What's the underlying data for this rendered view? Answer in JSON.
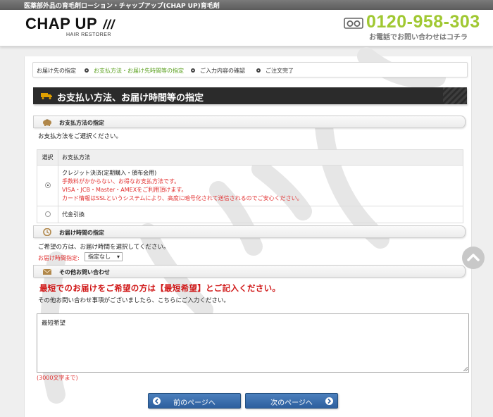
{
  "topbar": {
    "text": "医薬部外品の育毛剤ローション・チャップアップ(CHAP UP)育毛剤"
  },
  "header": {
    "logo": "CHAP UP",
    "logo_sub": "HAIR RESTORER",
    "phone": "0120-958-303",
    "phone_sub": "お電話でお問い合わせはコチラ"
  },
  "steps": [
    {
      "label": "お届け先の指定"
    },
    {
      "label": "お支払方法・お届け先時間等の指定"
    },
    {
      "label": "ご入力内容の確認"
    },
    {
      "label": "ご注文完了"
    }
  ],
  "page_title": "お支払い方法、お届け時間等の指定",
  "payment": {
    "section_title": "お支払方法の指定",
    "instruction": "お支払方法をご選択ください。",
    "col_select": "選択",
    "col_method": "お支払方法",
    "credit": {
      "title": "クレジット決済(定期購入・頒布会用)",
      "line1": "手数料がかからない、お得なお支払方法です。",
      "line2": "VISA・JCB・Master・AMEXをご利用頂けます。",
      "line3": "カード情報はSSLというシステムにより、高度に暗号化されて送信されるのでご安心ください。"
    },
    "cod": {
      "title": "代金引換"
    }
  },
  "delivery": {
    "section_title": "お届け時間の指定",
    "instruction": "ご希望の方は、お届け時間を選択してください。",
    "label": "お届け時間指定:",
    "selected": "指定なし"
  },
  "inquiry": {
    "section_title": "その他お問い合わせ",
    "notice": "最短でのお届けをご希望の方は【最短希望】とご記入ください。",
    "instruction": "その他お問い合わせ事項がございましたら、こちらにご入力ください。",
    "value": "最短希望",
    "limit": "(3000文字まで)"
  },
  "buttons": {
    "prev": "前のページへ",
    "next": "次のページへ"
  },
  "colors": {
    "accent_green": "#a0c832",
    "button_blue": "#3a6eae",
    "alert_red": "#e23030"
  }
}
